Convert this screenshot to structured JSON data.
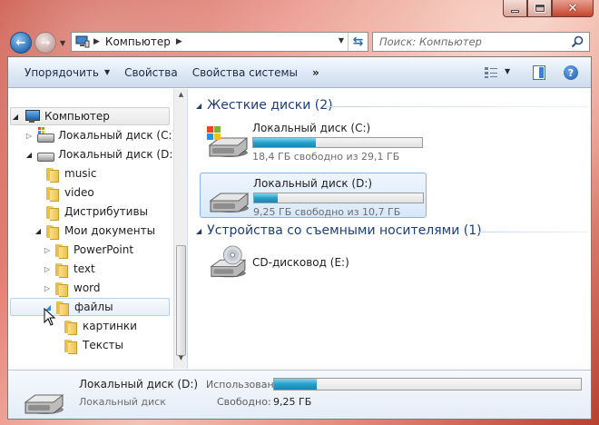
{
  "window": {
    "caption_buttons": {
      "minimize": "minimize",
      "maximize": "maximize",
      "close": "✕"
    }
  },
  "nav": {
    "address": "Компьютер",
    "search_placeholder": "Поиск: Компьютер"
  },
  "toolbar": {
    "organize": "Упорядочить",
    "properties": "Свойства",
    "system_properties": "Свойства системы",
    "more": "»"
  },
  "tree": {
    "computer": "Компьютер",
    "drive_c": "Локальный диск (C:)",
    "drive_d": "Локальный диск (D:)",
    "music": "music",
    "video": "video",
    "distributives": "Дистрибутивы",
    "my_documents": "Мои документы",
    "powerpoint": "PowerPoint",
    "text": "text",
    "word": "word",
    "files": "файлы",
    "pictures": "картинки",
    "texts": "Тексты"
  },
  "content": {
    "hard_disks_header": "Жесткие диски (2)",
    "removable_header": "Устройства со съемными носителями (1)",
    "drives": [
      {
        "name": "Локальный диск (C:)",
        "free_text": "18,4 ГБ свободно из 29,1 ГБ",
        "used_fraction": 0.37
      },
      {
        "name": "Локальный диск (D:)",
        "free_text": "9,25 ГБ свободно из 10,7 ГБ",
        "used_fraction": 0.14
      }
    ],
    "cd_drive": "CD-дисковод (E:)"
  },
  "details": {
    "name": "Локальный диск (D:)",
    "type": "Локальный диск",
    "used_label": "Использовано:",
    "used_fraction": 0.14,
    "free_label": "Свободно:",
    "free_value": "9,25 ГБ"
  },
  "colors": {
    "accent": "#1e3e7a",
    "bar_fill": "#27a0c9",
    "selection": "#d8e8fa"
  }
}
